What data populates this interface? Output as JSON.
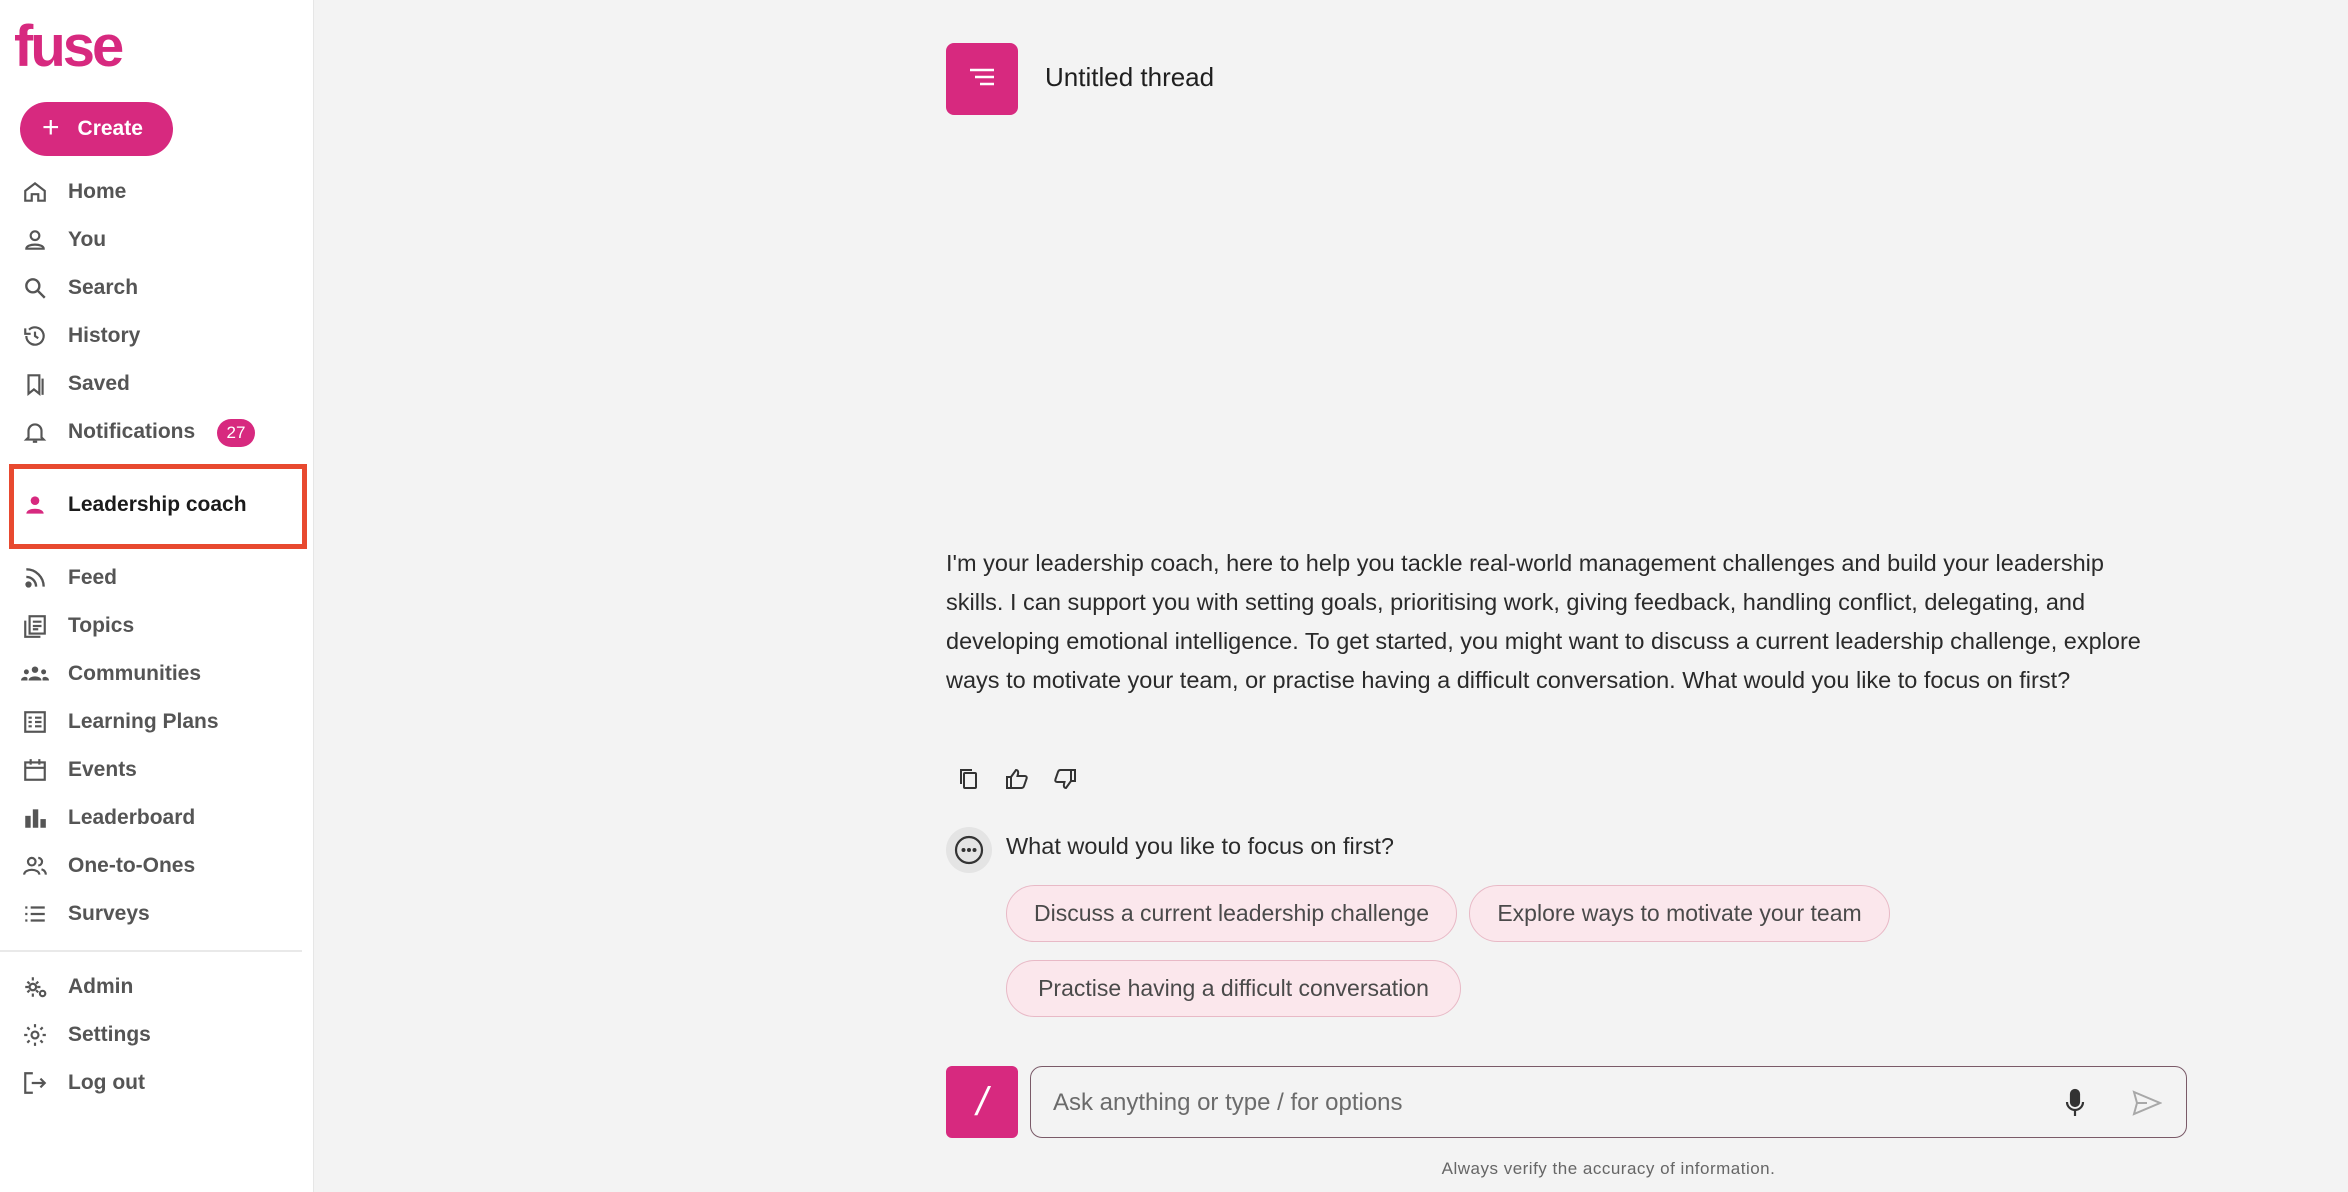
{
  "brand": {
    "logo_text": "fuse",
    "accent": "#d7297f"
  },
  "sidebar": {
    "create_label": "Create",
    "items": [
      {
        "label": "Home",
        "icon": "home-icon"
      },
      {
        "label": "You",
        "icon": "person-icon"
      },
      {
        "label": "Search",
        "icon": "search-icon"
      },
      {
        "label": "History",
        "icon": "history-icon"
      },
      {
        "label": "Saved",
        "icon": "bookmark-icon"
      },
      {
        "label": "Notifications",
        "icon": "bell-icon",
        "badge": "27"
      },
      {
        "label": "Leadership coach",
        "icon": "person-icon",
        "active": true
      },
      {
        "label": "Feed",
        "icon": "rss-icon"
      },
      {
        "label": "Topics",
        "icon": "topics-icon"
      },
      {
        "label": "Communities",
        "icon": "groups-icon"
      },
      {
        "label": "Learning Plans",
        "icon": "plan-icon"
      },
      {
        "label": "Events",
        "icon": "calendar-icon"
      },
      {
        "label": "Leaderboard",
        "icon": "bar-chart-icon"
      },
      {
        "label": "One-to-Ones",
        "icon": "people-icon"
      },
      {
        "label": "Surveys",
        "icon": "list-icon"
      },
      {
        "label": "Admin",
        "icon": "admin-gear-icon"
      },
      {
        "label": "Settings",
        "icon": "gear-icon"
      },
      {
        "label": "Log out",
        "icon": "logout-icon"
      }
    ]
  },
  "thread": {
    "title": "Untitled thread",
    "message": "I'm your leadership coach, here to help you tackle real-world management challenges and build your leadership skills. I can support you with setting goals, prioritising work, giving feedback, handling conflict, delegating, and developing emotional intelligence. To get started, you might want to discuss a current leadership challenge, explore ways to motivate your team, or practise having a difficult conversation. What would you like to focus on first?",
    "suggestion_question": "What would you like to focus on first?",
    "suggestions": [
      "Discuss a current leadership challenge",
      "Explore ways to motivate your team",
      "Practise having a difficult conversation"
    ]
  },
  "composer": {
    "slash_label": "/",
    "placeholder": "Ask anything or type / for options",
    "disclaimer": "Always verify the accuracy of information."
  }
}
